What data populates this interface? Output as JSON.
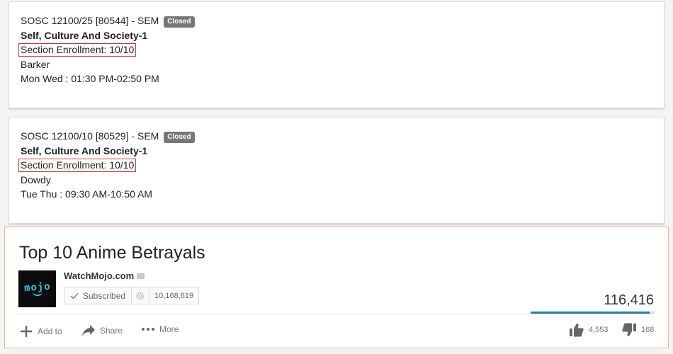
{
  "sections": [
    {
      "code": "SOSC 12100/25 [80544] - SEM",
      "status": "Closed",
      "title": "Self, Culture And Society-1",
      "enrollment": "Section Enrollment: 10/10",
      "instructor": "Barker",
      "schedule": "Mon Wed : 01:30 PM-02:50 PM"
    },
    {
      "code": "SOSC 12100/10 [80529] - SEM",
      "status": "Closed",
      "title": "Self, Culture And Society-1",
      "enrollment": "Section Enrollment: 10/10",
      "instructor": "Dowdy",
      "schedule": "Tue Thu : 09:30 AM-10:50 AM"
    }
  ],
  "video": {
    "title": "Top 10 Anime Betrayals",
    "logo_text": "mojo",
    "channel": "WatchMojo.com",
    "subscribe_label": "Subscribed",
    "subscriber_count": "10,168,619",
    "views": "116,416",
    "like_ratio": 0.964,
    "actions": {
      "add_to": "Add to",
      "share": "Share",
      "more": "More"
    },
    "likes": "4,553",
    "dislikes": "168"
  },
  "colors": {
    "highlight_border": "#d2372b",
    "badge_bg": "#777777",
    "accent_bar": "#1f7fa8",
    "logo_text": "#2fc4d8"
  },
  "icons": [
    "plus-icon",
    "share-arrow-icon",
    "more-dots-icon",
    "thumbs-up-icon",
    "thumbs-down-icon",
    "checkmark-icon",
    "gear-icon",
    "verified-icon"
  ]
}
